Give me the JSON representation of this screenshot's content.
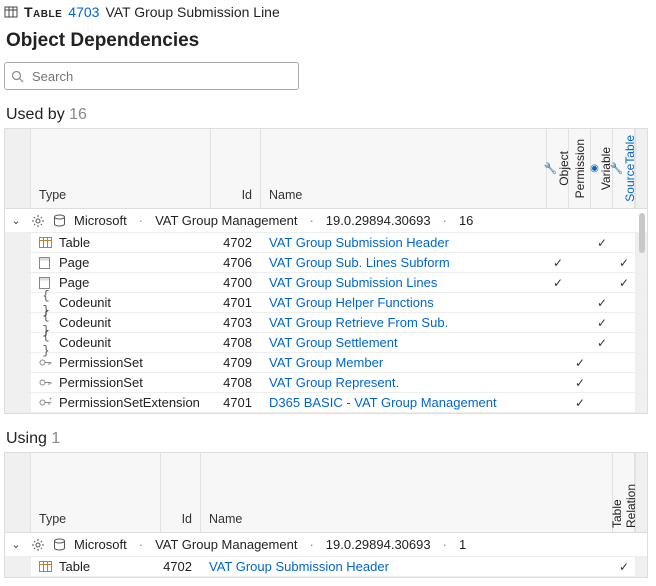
{
  "header": {
    "icon": "table-icon",
    "type_label": "Table",
    "id": "4703",
    "name": "VAT Group Submission Line"
  },
  "section_title": "Object Dependencies",
  "search": {
    "placeholder": "Search"
  },
  "used_by": {
    "label": "Used by",
    "count": "16",
    "columns": {
      "type": "Type",
      "id": "Id",
      "name": "Name",
      "object": "Object",
      "permission": "Permission",
      "variable": "Variable",
      "source_table": "SourceTable"
    },
    "group": {
      "publisher": "Microsoft",
      "app": "VAT Group Management",
      "version": "19.0.29894.30693",
      "count": "16"
    },
    "rows": [
      {
        "kind": "Table",
        "icon": "table",
        "id": "4702",
        "name": "VAT Group Submission Header",
        "obj": false,
        "perm": false,
        "var": true,
        "src": false
      },
      {
        "kind": "Page",
        "icon": "page",
        "id": "4706",
        "name": "VAT Group Sub. Lines Subform",
        "obj": true,
        "perm": false,
        "var": false,
        "src": true
      },
      {
        "kind": "Page",
        "icon": "page",
        "id": "4700",
        "name": "VAT Group Submission Lines",
        "obj": true,
        "perm": false,
        "var": false,
        "src": true
      },
      {
        "kind": "Codeunit",
        "icon": "code",
        "id": "4701",
        "name": "VAT Group Helper Functions",
        "obj": false,
        "perm": false,
        "var": true,
        "src": false
      },
      {
        "kind": "Codeunit",
        "icon": "code",
        "id": "4703",
        "name": "VAT Group Retrieve From Sub.",
        "obj": false,
        "perm": false,
        "var": true,
        "src": false
      },
      {
        "kind": "Codeunit",
        "icon": "code",
        "id": "4708",
        "name": "VAT Group Settlement",
        "obj": false,
        "perm": false,
        "var": true,
        "src": false
      },
      {
        "kind": "PermissionSet",
        "icon": "key",
        "id": "4709",
        "name": "VAT Group Member",
        "obj": false,
        "perm": true,
        "var": false,
        "src": false
      },
      {
        "kind": "PermissionSet",
        "icon": "key",
        "id": "4708",
        "name": "VAT Group Represent.",
        "obj": false,
        "perm": true,
        "var": false,
        "src": false
      },
      {
        "kind": "PermissionSetExtension",
        "icon": "keyext",
        "id": "4701",
        "name": "D365 BASIC - VAT Group Management",
        "obj": false,
        "perm": true,
        "var": false,
        "src": false
      }
    ]
  },
  "using": {
    "label": "Using",
    "count": "1",
    "columns": {
      "type": "Type",
      "id": "Id",
      "name": "Name",
      "table_relation": "Table Relation"
    },
    "group": {
      "publisher": "Microsoft",
      "app": "VAT Group Management",
      "version": "19.0.29894.30693",
      "count": "1"
    },
    "rows": [
      {
        "kind": "Table",
        "icon": "table",
        "id": "4702",
        "name": "VAT Group Submission Header",
        "tr": true
      }
    ]
  },
  "glyphs": {
    "sep": "·",
    "check": "✓",
    "chev": "⌄"
  }
}
